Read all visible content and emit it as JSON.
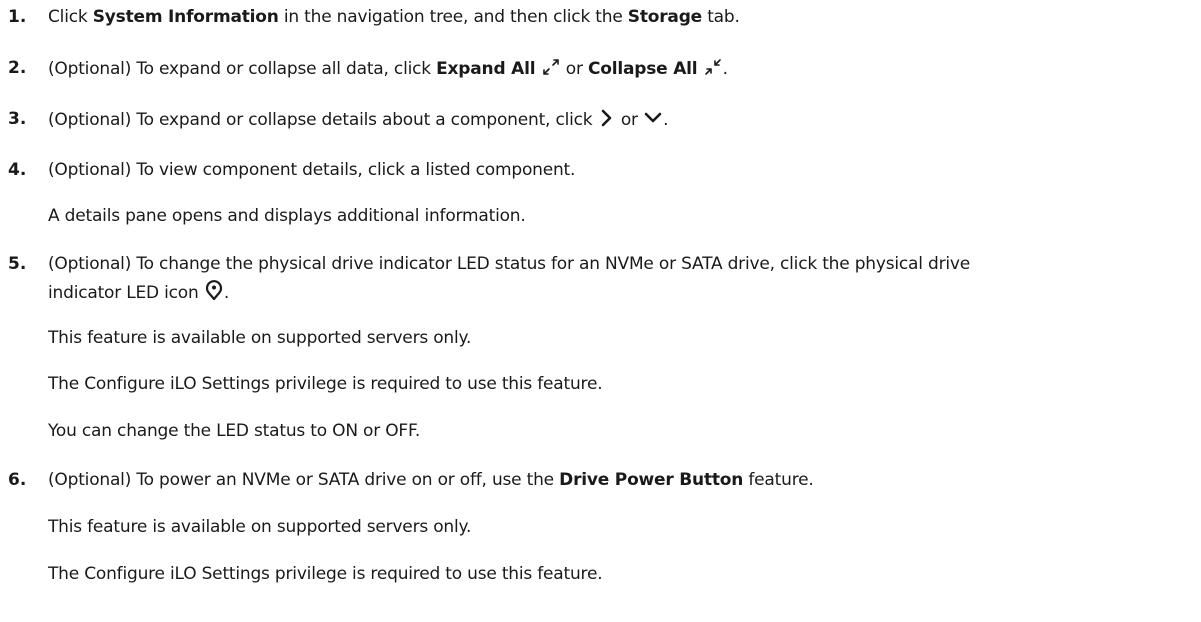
{
  "steps": [
    {
      "number": "1.",
      "pre": "Click ",
      "bold1": "System Information",
      "mid": " in the navigation tree, and then click the ",
      "bold2": "Storage",
      "post": " tab."
    },
    {
      "number": "2.",
      "pre": "(Optional) To expand or collapse all data, click ",
      "bold1": "Expand All",
      "icon1": "expand-all-icon",
      "mid": " or ",
      "bold2": "Collapse All",
      "icon2": "collapse-all-icon",
      "post": "."
    },
    {
      "number": "3.",
      "pre": "(Optional) To expand or collapse details about a component, click ",
      "icon1": "chevron-right-icon",
      "mid": " or ",
      "icon2": "chevron-down-icon",
      "post": "."
    },
    {
      "number": "4.",
      "text": "(Optional) To view component details, click a listed component.",
      "notes": [
        "A details pane opens and displays additional information."
      ]
    },
    {
      "number": "5.",
      "line1": "(Optional) To change the physical drive indicator LED status for an NVMe or SATA drive, click the physical drive",
      "line2": "indicator LED icon",
      "icon": "led-indicator-icon",
      "post": ".",
      "notes": [
        "This feature is available on supported servers only.",
        "The Configure iLO Settings privilege is required to use this feature.",
        "You can change the LED status to ON or OFF."
      ]
    },
    {
      "number": "6.",
      "pre": "(Optional) To power an NVMe or SATA drive on or off, use the ",
      "bold1": "Drive Power Button",
      "post": " feature.",
      "notes": [
        "This feature is available on supported servers only.",
        "The Configure iLO Settings privilege is required to use this feature."
      ]
    }
  ]
}
